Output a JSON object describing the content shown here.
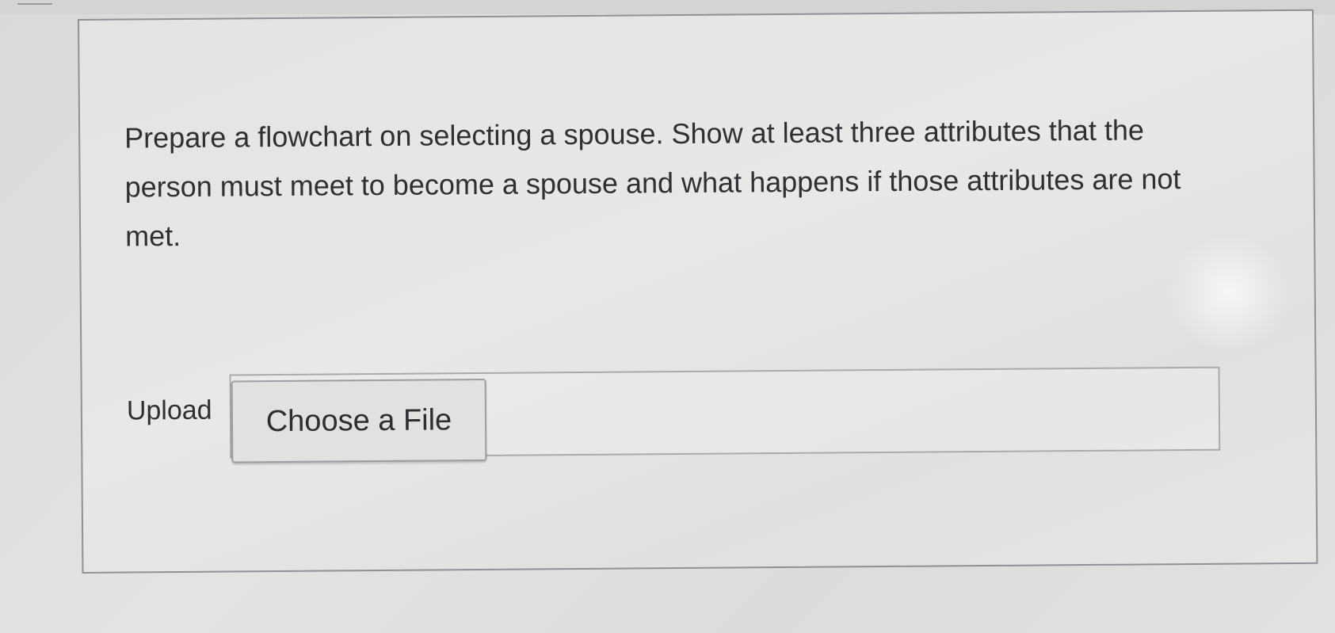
{
  "question": {
    "text": "Prepare a flowchart on selecting a spouse.  Show at least three attributes that the person must meet to become a spouse and what happens if those attributes are not met."
  },
  "upload": {
    "label": "Upload",
    "button_label": "Choose a File"
  }
}
